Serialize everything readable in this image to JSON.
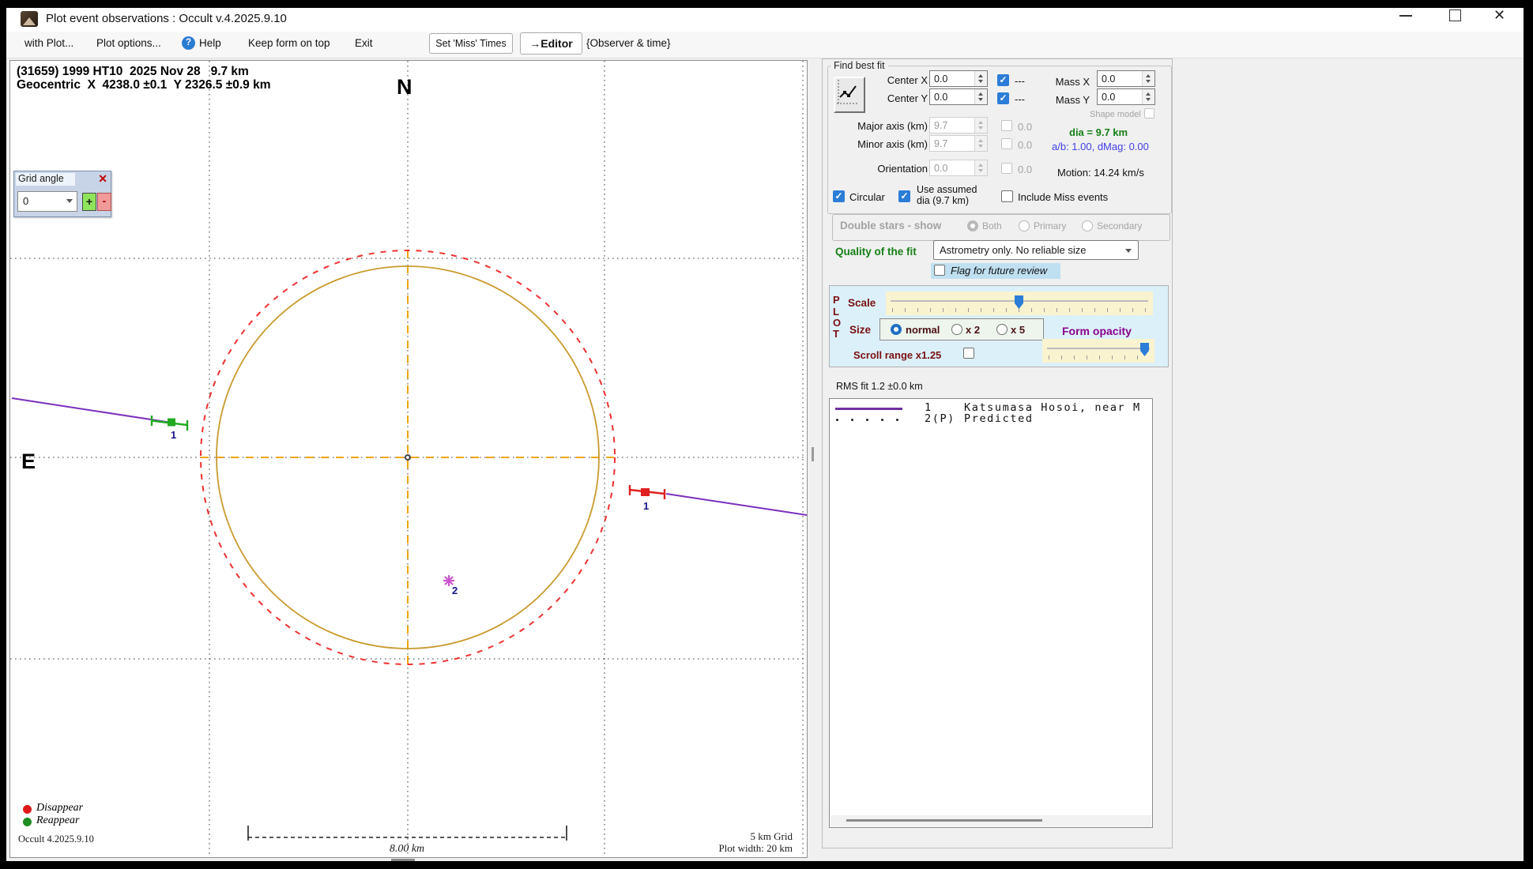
{
  "window": {
    "title": "Plot event observations : Occult v.4.2025.9.10"
  },
  "icons": {
    "help_glyph": "?",
    "close_glyph": "✕",
    "grid_angle_close": "✕"
  },
  "menu": {
    "with_plot": "with Plot...",
    "plot_options": "Plot options...",
    "help": "Help",
    "keep_on_top": "Keep form on top",
    "exit": "Exit",
    "set_miss_times": "Set 'Miss' Times",
    "editor": "→Editor",
    "observer_time": "{Observer & time}"
  },
  "plot": {
    "header1": "(31659) 1999 HT10  2025 Nov 28   9.7 km",
    "header2": "Geocentric  X  4238.0 ±0.1  Y 2326.5 ±0.9 km",
    "north": "N",
    "east": "E",
    "grid_angle": {
      "title": "Grid angle",
      "value": "0",
      "plus": "+",
      "minus": "-"
    },
    "chord1_label": "1",
    "star2_label": "2",
    "legend": {
      "disappear": "Disappear",
      "reappear": "Reappear"
    },
    "version": "Occult 4.2025.9.10",
    "scale_bar": "8.00 km",
    "grid_note": "5 km Grid",
    "width_note": "Plot width: 20 km"
  },
  "fit": {
    "title": "Find best fit",
    "center_x": {
      "label": "Center X",
      "value": "0.0",
      "dash": "---"
    },
    "center_y": {
      "label": "Center Y",
      "value": "0.0",
      "dash": "---"
    },
    "mass_x": {
      "label": "Mass X",
      "value": "0.0"
    },
    "mass_y": {
      "label": "Mass Y",
      "value": "0.0"
    },
    "shape_model": "Shape model",
    "major_axis": {
      "label": "Major axis (km)",
      "value": "9.7",
      "aux": "0.0"
    },
    "minor_axis": {
      "label": "Minor axis (km)",
      "value": "9.7",
      "aux": "0.0"
    },
    "orientation": {
      "label": "Orientation",
      "value": "0.0",
      "aux": "0.0"
    },
    "dia": "dia = 9.7 km",
    "ab": "a/b: 1.00, dMag: 0.00",
    "motion": "Motion: 14.24 km/s",
    "circular": "Circular",
    "use_assumed_1": "Use assumed",
    "use_assumed_2": "dia (9.7 km)",
    "include_miss": "Include Miss events"
  },
  "double_stars": {
    "title": "Double stars - show",
    "both": "Both",
    "primary": "Primary",
    "secondary": "Secondary"
  },
  "quality": {
    "label": "Quality of the fit",
    "value": "Astrometry only. No reliable size",
    "flag": "Flag for future review"
  },
  "plot_controls": {
    "p": "P",
    "l": "L",
    "o": "O",
    "t": "T",
    "scale": "Scale",
    "size": "Size",
    "size_normal": "normal",
    "size_x2": "x 2",
    "size_x5": "x 5",
    "form_opacity": "Form opacity",
    "scroll_range": "Scroll range x1.25"
  },
  "rms": "RMS fit 1.2 ±0.0 km",
  "observers": [
    {
      "num": "1",
      "name": "Katsumasa Hosoi, near M"
    },
    {
      "num": "2(P)",
      "name": "Predicted"
    }
  ],
  "colors": {
    "fitted_circle": "#c99a2e",
    "predicted_circle": "#f03030",
    "chord": "#7b2fbe",
    "disappear": "#e01818",
    "reappear": "#1f8c1f",
    "star": "#cc55cc",
    "accent_blue": "#2b7dd8"
  }
}
